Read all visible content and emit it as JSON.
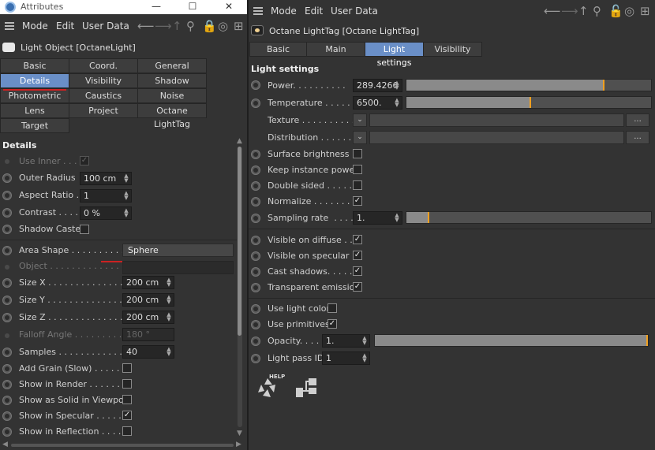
{
  "window": {
    "title": "Attributes",
    "buttons": {
      "minimize": "—",
      "maximize": "☐",
      "close": "✕"
    }
  },
  "left": {
    "menu": [
      "Mode",
      "Edit",
      "User Data"
    ],
    "object_title": "Light Object [OctaneLight]",
    "tabs": [
      "Basic",
      "Coord.",
      "General",
      "Details",
      "Visibility",
      "Shadow",
      "Photometric",
      "Caustics",
      "Noise",
      "Lens",
      "Project",
      "Octane LightTag",
      "Target"
    ],
    "active_tab": "Details",
    "section": "Details",
    "params": {
      "use_inner": {
        "label": "Use Inner . . .",
        "checked": true
      },
      "outer_radius": {
        "label": "Outer Radius",
        "value": "100 cm"
      },
      "aspect_ratio": {
        "label": "Aspect Ratio .",
        "value": "1"
      },
      "contrast": {
        "label": "Contrast . . . .",
        "value": "0 %"
      },
      "shadow_caster": {
        "label": "Shadow Caster",
        "checked": false
      },
      "area_shape": {
        "label": "Area Shape . . . . . . . . . .",
        "value": "Sphere"
      },
      "object": {
        "label": "Object . . . . . . . . . . . . . ."
      },
      "size_x": {
        "label": "Size X . . . . . . . . . . . . . .",
        "value": "200 cm"
      },
      "size_y": {
        "label": "Size Y . . . . . . . . . . . . . .",
        "value": "200 cm"
      },
      "size_z": {
        "label": "Size Z . . . . . . . . . . . . . .",
        "value": "200 cm"
      },
      "falloff_angle": {
        "label": "Falloff Angle . . . . . . . . .",
        "value": "180 °"
      },
      "samples": {
        "label": "Samples . . . . . . . . . . . . .",
        "value": "40"
      },
      "add_grain": {
        "label": "Add Grain (Slow) . . . . . .",
        "checked": false
      },
      "show_in_render": {
        "label": "Show in Render . . . . . . .",
        "checked": false
      },
      "show_as_solid": {
        "label": "Show as Solid in Viewport",
        "checked": false
      },
      "show_in_specular": {
        "label": "Show in Specular . . . . . .",
        "checked": true
      },
      "show_in_reflection": {
        "label": "Show in Reflection . . . . .",
        "checked": false
      }
    }
  },
  "right": {
    "menu": [
      "Mode",
      "Edit",
      "User Data"
    ],
    "object_title": "Octane LightTag [Octane LightTag]",
    "tabs": [
      "Basic",
      "Main",
      "Light settings",
      "Visibility"
    ],
    "active_tab": "Light settings",
    "section": "Light settings",
    "params": {
      "power": {
        "label": "Power. . . . . . . . . .",
        "value": "289.4266",
        "fraction": 0.81
      },
      "temperature": {
        "label": "Temperature . . . . .",
        "value": "6500.",
        "fraction": 0.51
      },
      "texture": {
        "label": "Texture . . . . . . . . . .",
        "button": "..."
      },
      "distribution": {
        "label": "Distribution . . . . . .",
        "button": "..."
      },
      "surface_brightness": {
        "label": "Surface brightness . .",
        "checked": false
      },
      "keep_instance_power": {
        "label": "Keep instance power",
        "checked": false
      },
      "double_sided": {
        "label": "Double sided . . . . .",
        "checked": false
      },
      "normalize": {
        "label": "Normalize . . . . . . . .",
        "checked": true
      },
      "sampling_rate": {
        "label": "Sampling rate  . . . .",
        "value": "1.",
        "fraction": 0.095
      },
      "visible_on_diffuse": {
        "label": "Visible on diffuse . .",
        "checked": true
      },
      "visible_on_specular": {
        "label": "Visible on specular .",
        "checked": true
      },
      "cast_shadows": {
        "label": "Cast shadows. . . . .",
        "checked": true
      },
      "transparent_emission": {
        "label": "Transparent emission",
        "checked": true
      },
      "use_light_color": {
        "label": "Use light color",
        "checked": false
      },
      "use_primitives": {
        "label": "Use primitives",
        "checked": true
      },
      "opacity": {
        "label": "Opacity. . . . .",
        "value": "1.",
        "fraction": 1.0
      },
      "light_pass_id": {
        "label": "Light pass ID",
        "value": "1"
      }
    },
    "help_label": "HELP"
  },
  "colors": {
    "active_tab": "#6a8fc7",
    "slider_marker": "#f0a020",
    "annotation_line": "#cc2222"
  }
}
